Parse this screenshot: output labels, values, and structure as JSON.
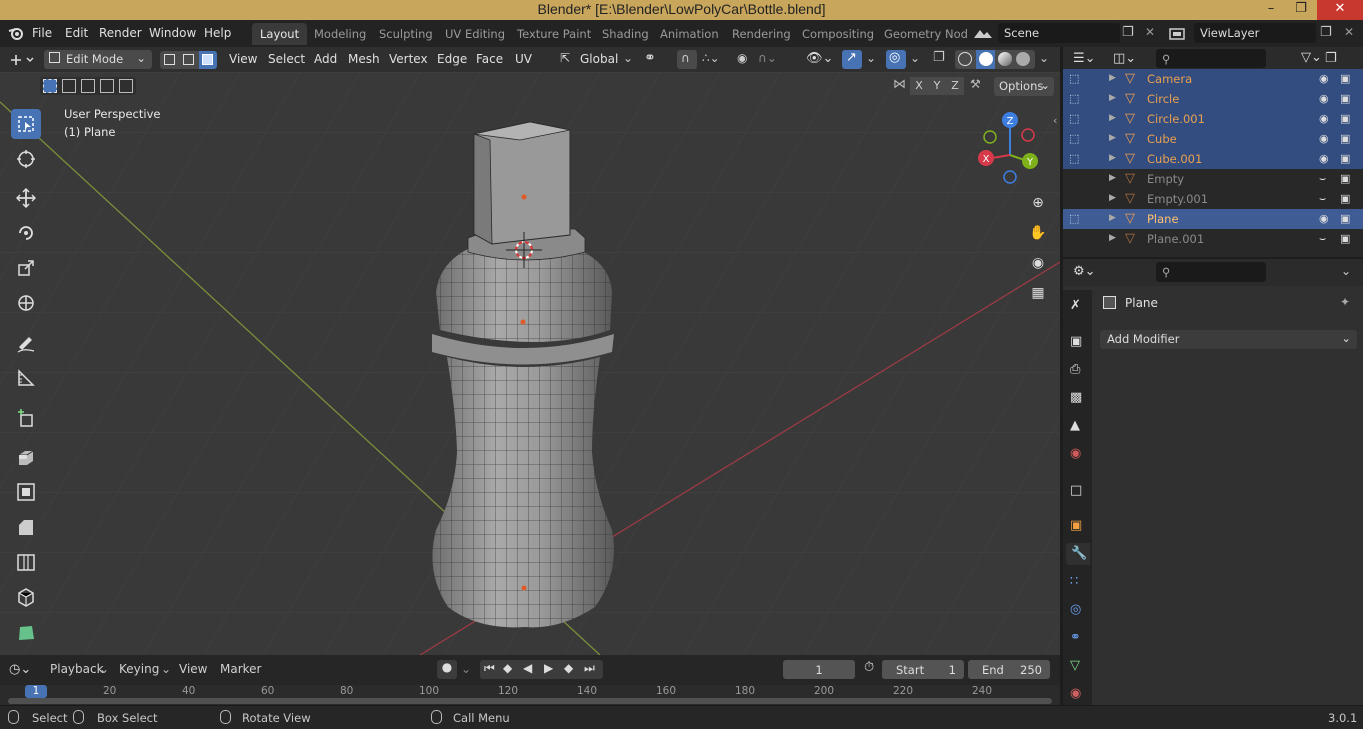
{
  "window": {
    "title": "Blender* [E:\\Blender\\LowPolyCar\\Bottle.blend]"
  },
  "menu": [
    "File",
    "Edit",
    "Render",
    "Window",
    "Help"
  ],
  "workspaces": [
    {
      "label": "Layout",
      "active": true
    },
    {
      "label": "Modeling"
    },
    {
      "label": "Sculpting"
    },
    {
      "label": "UV Editing"
    },
    {
      "label": "Texture Paint"
    },
    {
      "label": "Shading"
    },
    {
      "label": "Animation"
    },
    {
      "label": "Rendering"
    },
    {
      "label": "Compositing"
    },
    {
      "label": "Geometry Nod"
    }
  ],
  "scene": "Scene",
  "view_layer": "ViewLayer",
  "viewport_header": {
    "mode": "Edit Mode",
    "menus": [
      "View",
      "Select",
      "Add",
      "Mesh",
      "Vertex",
      "Edge",
      "Face",
      "UV"
    ],
    "orientation": "Global",
    "options": "Options",
    "axes": [
      "X",
      "Y",
      "Z"
    ]
  },
  "viewport": {
    "perspective": "User Perspective",
    "object": "(1) Plane",
    "gizmo_axes": [
      "X",
      "Y",
      "Z"
    ]
  },
  "outliner": {
    "rows": [
      {
        "name": "Camera",
        "selected": true,
        "color": "#e8a050"
      },
      {
        "name": "Circle",
        "selected": true,
        "color": "#e8a050"
      },
      {
        "name": "Circle.001",
        "selected": true,
        "color": "#e8a050"
      },
      {
        "name": "Cube",
        "selected": true,
        "color": "#e8a050"
      },
      {
        "name": "Cube.001",
        "selected": true,
        "color": "#e8a050"
      },
      {
        "name": "Empty",
        "selected": false,
        "color": "#8a8a8a"
      },
      {
        "name": "Empty.001",
        "selected": false,
        "color": "#8a8a8a"
      },
      {
        "name": "Plane",
        "selected": true,
        "active": true,
        "color": "#ffc070"
      },
      {
        "name": "Plane.001",
        "selected": false,
        "color": "#8a8a8a"
      }
    ]
  },
  "properties": {
    "object": "Plane",
    "add_modifier": "Add Modifier"
  },
  "timeline": {
    "menus": [
      "Playback",
      "Keying",
      "View",
      "Marker"
    ],
    "current_frame": "1",
    "start_label": "Start",
    "start": "1",
    "end_label": "End",
    "end": "250",
    "ticks": [
      "1",
      "20",
      "40",
      "60",
      "80",
      "100",
      "120",
      "140",
      "160",
      "180",
      "200",
      "220",
      "240"
    ]
  },
  "statusbar": {
    "select": "Select",
    "box_select": "Box Select",
    "rotate": "Rotate View",
    "call_menu": "Call Menu",
    "version": "3.0.1"
  },
  "colors": {
    "accent": "#4772b3",
    "titlebar": "#c8a75d",
    "object_orange": "#e8a050",
    "axis_x": "#d63a4a",
    "axis_y": "#7fb11b",
    "axis_z": "#3d7ee0"
  }
}
